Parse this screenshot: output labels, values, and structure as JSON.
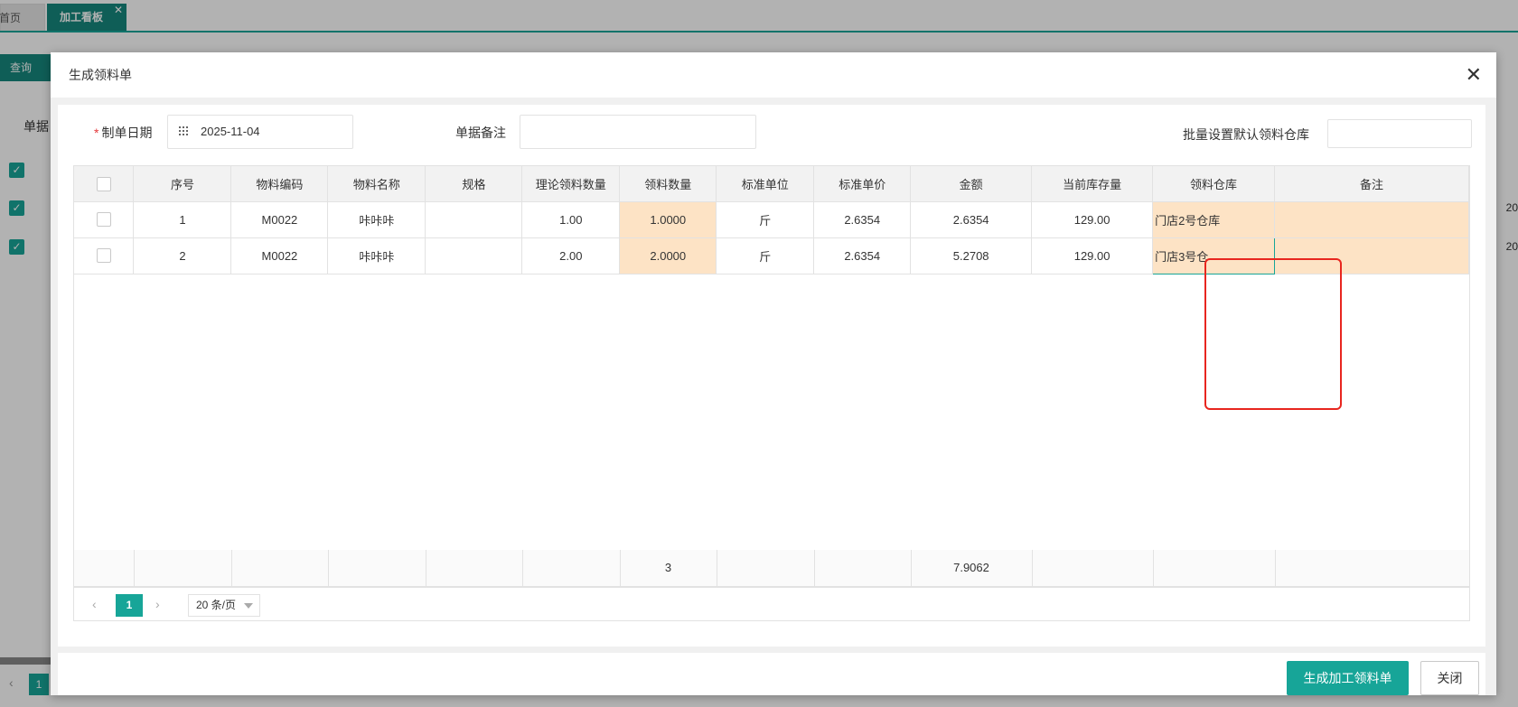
{
  "tabs": {
    "home": "首页",
    "active": "加工看板",
    "close": "✕"
  },
  "background": {
    "query_button": "查询",
    "label": "单据",
    "right_partial": "20",
    "pager_page": "1"
  },
  "modal": {
    "title": "生成领料单",
    "close": "✕",
    "form": {
      "date_label": "制单日期",
      "date_value": "2025-11-04",
      "remark_label": "单据备注",
      "remark_value": "",
      "batch_label": "批量设置默认领料仓库",
      "batch_value": ""
    },
    "table": {
      "headers": [
        "序号",
        "物料编码",
        "物料名称",
        "规格",
        "理论领料数量",
        "领料数量",
        "标准单位",
        "标准单价",
        "金额",
        "当前库存量",
        "领料仓库",
        "备注"
      ],
      "rows": [
        {
          "seq": "1",
          "code": "M0022",
          "name": "咔咔咔",
          "spec": "",
          "theory_qty": "1.00",
          "qty": "1.0000",
          "unit": "斤",
          "price": "2.6354",
          "amount": "2.6354",
          "stock": "129.00",
          "warehouse": "门店2号仓库",
          "remark": ""
        },
        {
          "seq": "2",
          "code": "M0022",
          "name": "咔咔咔",
          "spec": "",
          "theory_qty": "2.00",
          "qty": "2.0000",
          "unit": "斤",
          "price": "2.6354",
          "amount": "5.2708",
          "stock": "129.00",
          "warehouse": "门店3号仓",
          "remark": ""
        }
      ],
      "summary": {
        "qty_total": "3",
        "amount_total": "7.9062"
      }
    },
    "pager": {
      "prev": "‹",
      "page": "1",
      "next": "›",
      "size": "20 条/页"
    },
    "buttons": {
      "primary": "生成加工领料单",
      "close": "关闭"
    }
  },
  "colors": {
    "accent": "#17a598",
    "highlight": "#fde3c5",
    "annotation": "#e8261f"
  }
}
